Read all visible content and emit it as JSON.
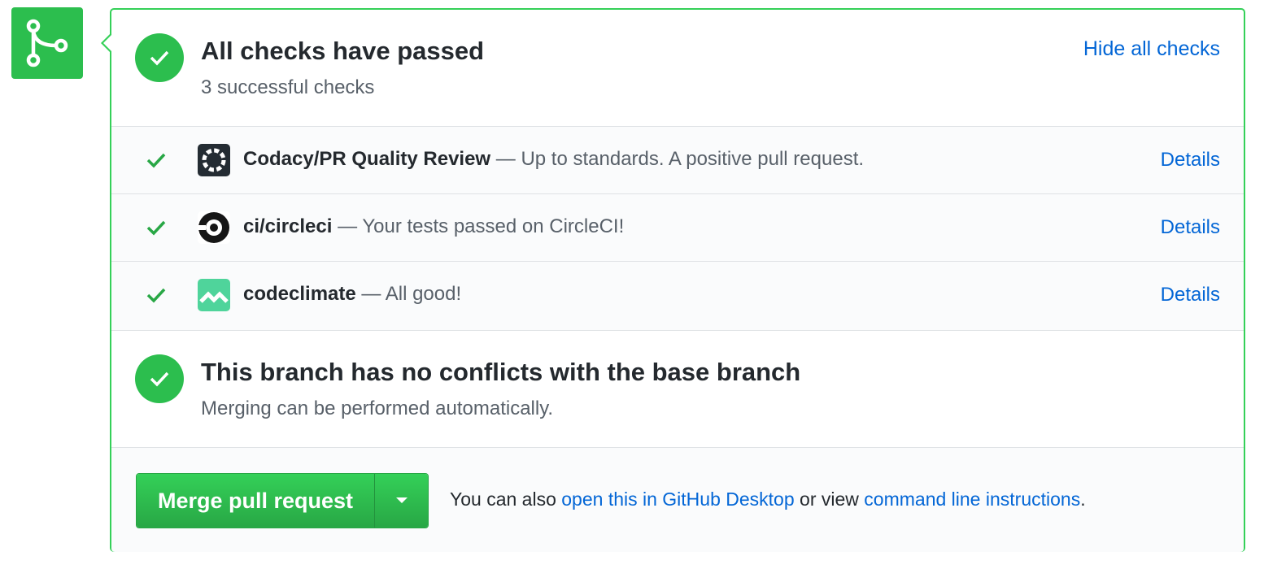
{
  "checks_summary": {
    "title": "All checks have passed",
    "subtitle": "3 successful checks",
    "toggle_link": "Hide all checks"
  },
  "checks": [
    {
      "name": "Codacy/PR Quality Review",
      "description": " — Up to standards. A positive pull request.",
      "details_label": "Details",
      "icon": "codacy-logo"
    },
    {
      "name": "ci/circleci",
      "description": " — Your tests passed on CircleCI!",
      "details_label": "Details",
      "icon": "circleci-logo"
    },
    {
      "name": "codeclimate",
      "description": " — All good!",
      "details_label": "Details",
      "icon": "codeclimate-logo"
    }
  ],
  "branch_status": {
    "title": "This branch has no conflicts with the base branch",
    "subtitle": "Merging can be performed automatically."
  },
  "merge": {
    "button_label": "Merge pull request",
    "hint_prefix": "You can also ",
    "desktop_link": "open this in GitHub Desktop",
    "hint_middle": " or view ",
    "cli_link": "command line instructions",
    "hint_suffix": "."
  },
  "colors": {
    "success_green": "#2cbe4e",
    "border_green": "#34d058",
    "link_blue": "#0366d6",
    "codacy_dark": "#242c33",
    "codeclimate_green": "#4fd49b"
  }
}
